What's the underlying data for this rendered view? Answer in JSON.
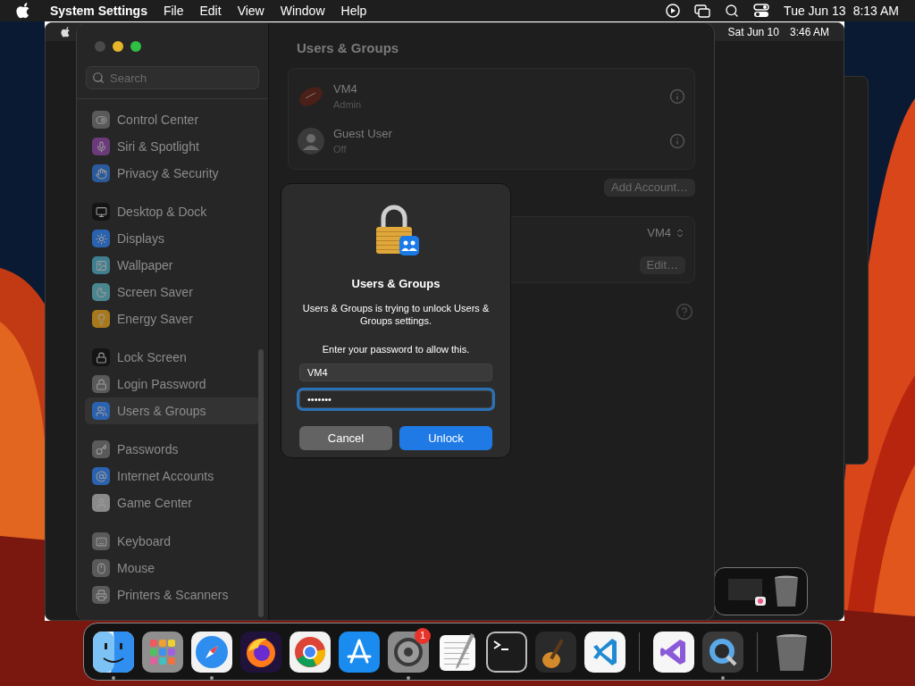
{
  "menu_bar": {
    "app_name": "System Settings",
    "menus": [
      "File",
      "Edit",
      "View",
      "Window",
      "Help"
    ],
    "date": "Tue Jun 13",
    "time": "8:13 AM"
  },
  "vm_window": {
    "date": "Sat Jun 10",
    "time": "3:46 AM"
  },
  "sidebar": {
    "search": {
      "placeholder": "Search"
    },
    "groups": [
      [
        {
          "label": "Control Center",
          "kind": "control",
          "selected": false
        },
        {
          "label": "Siri & Spotlight",
          "kind": "siri",
          "selected": false
        },
        {
          "label": "Privacy & Security",
          "kind": "privacy",
          "selected": false
        }
      ],
      [
        {
          "label": "Desktop & Dock",
          "kind": "dock",
          "selected": false
        },
        {
          "label": "Displays",
          "kind": "displays",
          "selected": false
        },
        {
          "label": "Wallpaper",
          "kind": "wallpaper",
          "selected": false
        },
        {
          "label": "Screen Saver",
          "kind": "screensaver",
          "selected": false
        },
        {
          "label": "Energy Saver",
          "kind": "energy",
          "selected": false
        }
      ],
      [
        {
          "label": "Lock Screen",
          "kind": "lock",
          "selected": false
        },
        {
          "label": "Login Password",
          "kind": "login",
          "selected": false
        },
        {
          "label": "Users & Groups",
          "kind": "users",
          "selected": true
        }
      ],
      [
        {
          "label": "Passwords",
          "kind": "passwords",
          "selected": false
        },
        {
          "label": "Internet Accounts",
          "kind": "internet",
          "selected": false
        },
        {
          "label": "Game Center",
          "kind": "game",
          "selected": false
        }
      ],
      [
        {
          "label": "Keyboard",
          "kind": "keyboard",
          "selected": false
        },
        {
          "label": "Mouse",
          "kind": "mouse",
          "selected": false
        },
        {
          "label": "Printers & Scanners",
          "kind": "printer",
          "selected": false
        }
      ]
    ]
  },
  "content": {
    "title": "Users & Groups",
    "users": [
      {
        "name": "VM4",
        "role": "Admin",
        "kind": "football"
      },
      {
        "name": "Guest User",
        "role": "Off",
        "kind": "guest"
      }
    ],
    "add_account_button": "Add Account…",
    "auto_login_value": "VM4",
    "edit_button": "Edit…"
  },
  "dialog": {
    "title": "Users & Groups",
    "message": "Users & Groups is trying to unlock Users & Groups settings.",
    "prompt": "Enter your password to allow this.",
    "username": "VM4",
    "password": "•••••••",
    "password_focused": true,
    "buttons": [
      {
        "label": "Cancel",
        "kind": "cancel"
      },
      {
        "label": "Unlock",
        "kind": "default"
      }
    ]
  },
  "dock": [
    {
      "kind": "finder",
      "running": true
    },
    {
      "kind": "launchpad",
      "running": false
    },
    {
      "kind": "safari",
      "running": true
    },
    {
      "kind": "firefox",
      "running": false
    },
    {
      "kind": "chrome",
      "running": false
    },
    {
      "kind": "appstore",
      "running": false
    },
    {
      "kind": "settings",
      "running": true,
      "badge": "1"
    },
    {
      "kind": "textedit",
      "running": false
    },
    {
      "kind": "terminal",
      "running": false
    },
    {
      "kind": "garageband",
      "running": false
    },
    {
      "kind": "vscode",
      "running": false
    },
    {
      "kind": "separator"
    },
    {
      "kind": "visualstudio",
      "running": false
    },
    {
      "kind": "quicktime",
      "running": true
    },
    {
      "kind": "separator"
    },
    {
      "kind": "trash",
      "running": false
    }
  ]
}
